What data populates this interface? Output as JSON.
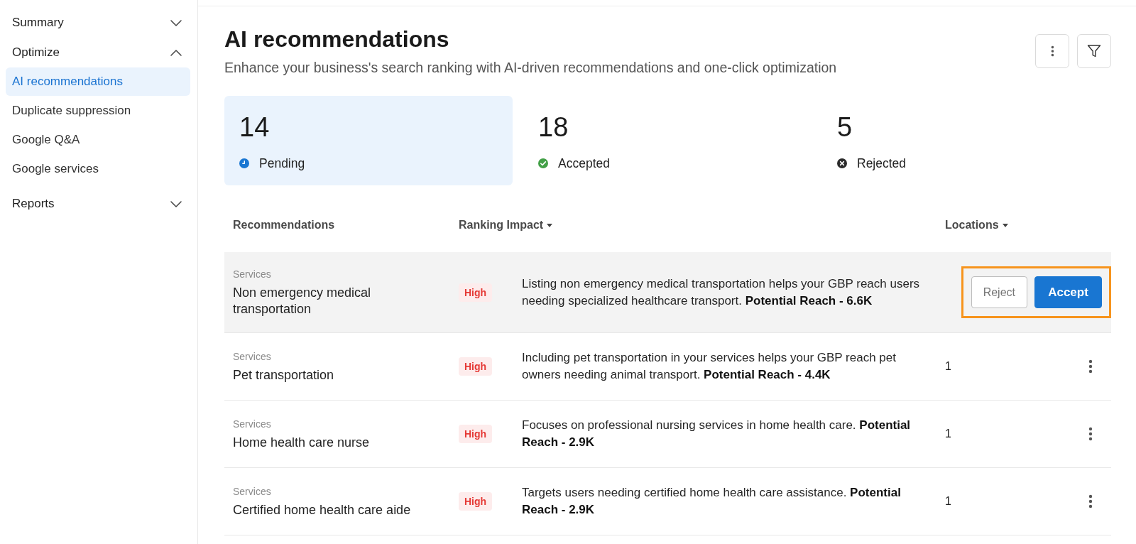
{
  "sidebar": {
    "sections": [
      {
        "label": "Summary",
        "expanded": false
      },
      {
        "label": "Optimize",
        "expanded": true,
        "children": [
          {
            "label": "AI recommendations",
            "selected": true
          },
          {
            "label": "Duplicate suppression",
            "selected": false
          },
          {
            "label": "Google Q&A",
            "selected": false
          },
          {
            "label": "Google services",
            "selected": false
          }
        ]
      },
      {
        "label": "Reports",
        "expanded": false
      }
    ]
  },
  "page": {
    "title": "AI recommendations",
    "subtitle": "Enhance your business's search ranking with AI-driven recommendations and one-click optimization"
  },
  "toolbar": {
    "buttons": [
      {
        "kind": "more"
      },
      {
        "kind": "filter"
      }
    ]
  },
  "stats": [
    {
      "kind": "pending",
      "count": "14",
      "label": "Pending",
      "selected": true
    },
    {
      "kind": "accepted",
      "count": "18",
      "label": "Accepted",
      "selected": false
    },
    {
      "kind": "rejected",
      "count": "5",
      "label": "Rejected",
      "selected": false
    }
  ],
  "table": {
    "columns": [
      {
        "label": "Recommendations",
        "sortable": false
      },
      {
        "label": "Ranking Impact",
        "sortable": true
      },
      {
        "label": "Locations",
        "sortable": true
      }
    ],
    "hover_actions": {
      "highlighted": true,
      "buttons": [
        {
          "label": "Reject",
          "kind": "secondary"
        },
        {
          "label": "Accept",
          "kind": "primary"
        }
      ]
    },
    "rows": [
      {
        "category": "Services",
        "name": "Non emergency medical transportation",
        "impact": "High",
        "description": "Listing non emergency medical transportation helps your GBP reach users needing specialized healthcare transport. **Potential Reach - 6.6K**",
        "hovered": true
      },
      {
        "category": "Services",
        "name": "Pet transportation",
        "impact": "High",
        "description": "Including pet transportation in your services helps your GBP reach pet owners needing animal transport. **Potential Reach - 4.4K**",
        "hovered": false,
        "locations": "1"
      },
      {
        "category": "Services",
        "name": "Home health care nurse",
        "impact": "High",
        "description": "Focuses on professional nursing services in home health care. **Potential Reach - 2.9K**",
        "hovered": false,
        "locations": "1"
      },
      {
        "category": "Services",
        "name": "Certified home health care aide",
        "impact": "High",
        "description": "Targets users needing certified home health care assistance. **Potential Reach - 2.9K**",
        "hovered": false,
        "locations": "1"
      }
    ]
  }
}
